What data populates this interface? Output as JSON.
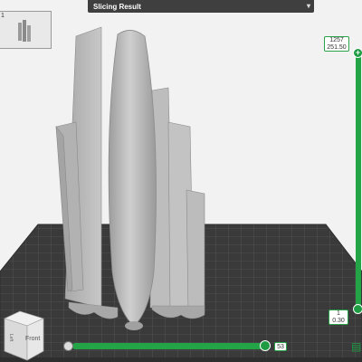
{
  "header": {
    "title": "Slicing Result",
    "collapse_icon": "double-chevron-down-icon"
  },
  "plate_thumbnail": {
    "number": "1"
  },
  "layer_slider": {
    "top_layer": "1257",
    "top_height": "251.50",
    "bottom_layer": "1",
    "bottom_height": "0.30",
    "colors": {
      "accent": "#22a447"
    }
  },
  "move_slider": {
    "value": "53"
  },
  "view_cube": {
    "front_label": "Front",
    "left_label": "Left"
  },
  "colors": {
    "accent": "#22a447",
    "bed": "#3a3a3a",
    "grid": "#5a5a5a",
    "model": "#b9b9b9"
  }
}
